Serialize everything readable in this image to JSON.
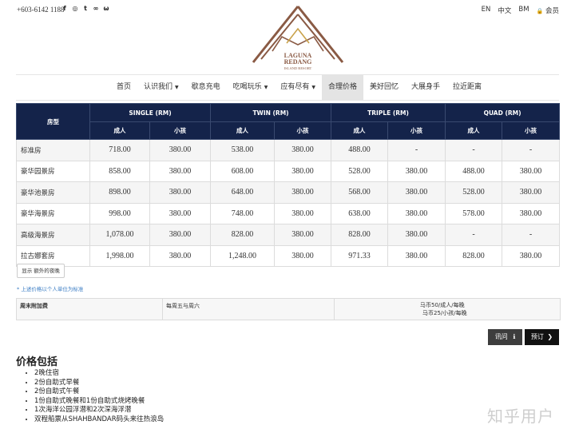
{
  "topbar": {
    "phone": "+603-6142 1188",
    "social_icons": [
      {
        "name": "facebook-icon",
        "glyph": "f"
      },
      {
        "name": "instagram-icon",
        "glyph": "◎"
      },
      {
        "name": "twitter-icon",
        "glyph": "t"
      },
      {
        "name": "tripadvisor-icon",
        "glyph": "∞"
      },
      {
        "name": "weibo-icon",
        "glyph": "ω"
      }
    ],
    "langs": [
      "EN",
      "中文",
      "BM"
    ],
    "login_icon": "lock-icon",
    "login_glyph": "🔒",
    "member": "会员"
  },
  "logo": {
    "line1": "LAGUNA",
    "line2": "REDANG",
    "line3": "ISLAND RESORT",
    "color": "#8a5a44"
  },
  "nav": {
    "items": [
      {
        "label": "首页",
        "dropdown": false,
        "active": false
      },
      {
        "label": "认识我们",
        "dropdown": true,
        "active": false
      },
      {
        "label": "歇息充电",
        "dropdown": false,
        "active": false
      },
      {
        "label": "吃喝玩乐",
        "dropdown": true,
        "active": false
      },
      {
        "label": "应有尽有",
        "dropdown": true,
        "active": false
      },
      {
        "label": "合理价格",
        "dropdown": false,
        "active": true
      },
      {
        "label": "美好回忆",
        "dropdown": false,
        "active": false
      },
      {
        "label": "大展身手",
        "dropdown": false,
        "active": false
      },
      {
        "label": "拉近距离",
        "dropdown": false,
        "active": false
      }
    ],
    "caret_glyph": "▼"
  },
  "rates": {
    "room_type_header": "房型",
    "groups": [
      "SINGLE (RM)",
      "TWIN (RM)",
      "TRIPLE (RM)",
      "QUAD (RM)"
    ],
    "adult": "成人",
    "child": "小孩",
    "rows": [
      {
        "name": "标准房",
        "values": [
          "718.00",
          "380.00",
          "538.00",
          "380.00",
          "488.00",
          "-",
          "-",
          "-"
        ]
      },
      {
        "name": "豪华园景房",
        "values": [
          "858.00",
          "380.00",
          "608.00",
          "380.00",
          "528.00",
          "380.00",
          "488.00",
          "380.00"
        ]
      },
      {
        "name": "豪华池景房",
        "values": [
          "898.00",
          "380.00",
          "648.00",
          "380.00",
          "568.00",
          "380.00",
          "528.00",
          "380.00"
        ]
      },
      {
        "name": "豪华海景房",
        "values": [
          "998.00",
          "380.00",
          "748.00",
          "380.00",
          "638.00",
          "380.00",
          "578.00",
          "380.00"
        ]
      },
      {
        "name": "高级海景房",
        "values": [
          "1,078.00",
          "380.00",
          "828.00",
          "380.00",
          "828.00",
          "380.00",
          "-",
          "-"
        ]
      },
      {
        "name": "拉古娜套房",
        "values": [
          "1,998.00",
          "380.00",
          "1,248.00",
          "380.00",
          "971.33",
          "380.00",
          "828.00",
          "380.00"
        ]
      }
    ]
  },
  "extra_night_button": "显示 额外的夜晚",
  "note": "* 上述价格以个人单位为标准",
  "surcharge": {
    "label": "周末附加费",
    "days": "每周五与周六",
    "adult_rate": "马币50/成人/每晚",
    "child_rate": "马币25/小孩/每晚"
  },
  "buttons": {
    "enquire": "讯问",
    "enquire_icon_glyph": "ℹ",
    "book": "预订",
    "book_icon_glyph": "❯"
  },
  "includes": {
    "title": "价格包括",
    "items": [
      "2晚住宿",
      "2份自助式早餐",
      "2份自助式午餐",
      "1份自助式晚餐和1份自助式烧烤晚餐",
      "1次海洋公园浮潜和2次深海浮潜",
      "双程船票从SHAHBANDAR码头来往热浪岛"
    ]
  },
  "watermark": "知乎用户"
}
